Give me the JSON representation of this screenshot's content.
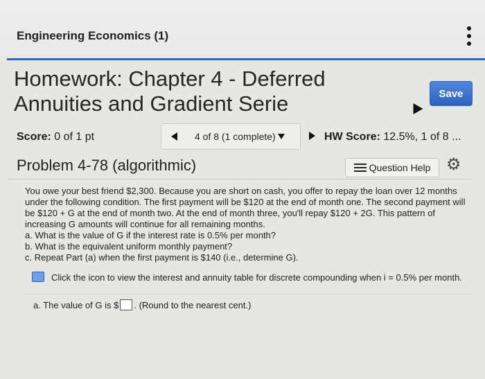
{
  "header": {
    "course_title": "Engineering Economics (1)",
    "menu_icon": "kebab-menu-icon"
  },
  "assignment": {
    "title": "Homework: Chapter 4 - Deferred Annuities and Gradient Serie",
    "save_label": "Save"
  },
  "score_bar": {
    "score_label": "Score:",
    "score_value": "0 of 1 pt",
    "question_nav": "4 of 8 (1 complete)",
    "hw_score_label": "HW Score:",
    "hw_score_value": "12.5%, 1 of 8 ..."
  },
  "problem": {
    "title": "Problem 4-78 (algorithmic)",
    "help_label": "Question Help",
    "paragraphs": [
      "You owe your best friend $2,300. Because you are short on cash, you offer to repay the loan over 12 months under the following condition. The first payment will be $120 at the end of month one. The second payment will be $120 + G at the end of month two. At the end of month three, you'll repay $120 + 2G. This pattern of increasing G amounts will continue for all remaining months.",
      "a. What is the value of G if the interest rate is 0.5% per month?",
      "b. What is the equivalent uniform monthly payment?",
      "c. Repeat Part (a) when the first payment is $140 (i.e., determine G)."
    ],
    "table_link": "Click the icon to view the interest and annuity table for discrete compounding when i = 0.5% per month."
  },
  "answer": {
    "prefix": "a. The value of G is $",
    "suffix": ". (Round to the nearest cent.)",
    "value": ""
  }
}
